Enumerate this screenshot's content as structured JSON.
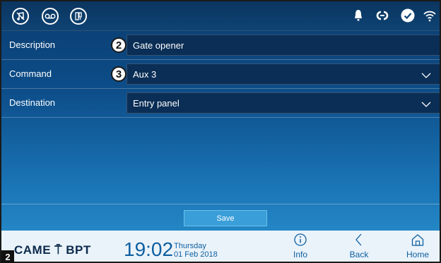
{
  "topbar": {
    "left_icons": [
      "music-note-icon",
      "voicemail-icon",
      "intercom-panel-icon"
    ],
    "status_icons": [
      "bell-icon",
      "link-icon",
      "check-icon",
      "wifi-icon"
    ]
  },
  "form": {
    "rows": [
      {
        "label": "Description",
        "value": "Gate opener",
        "callout": "2"
      },
      {
        "label": "Command",
        "value": "Aux 3",
        "callout": "3"
      },
      {
        "label": "Destination",
        "value": "Entry panel"
      }
    ]
  },
  "save": {
    "label": "Save"
  },
  "footer": {
    "brand": "CAME ⍑ BPT",
    "time": "19:02",
    "day": "Thursday",
    "date": "01 Feb 2018",
    "nav": {
      "info": "Info",
      "back": "Back",
      "home": "Home"
    }
  },
  "figure_number": "2",
  "colors": {
    "accent": "#0f5fa0",
    "field_bg": "#0a2e55",
    "save_button": "#3a9fd8"
  }
}
